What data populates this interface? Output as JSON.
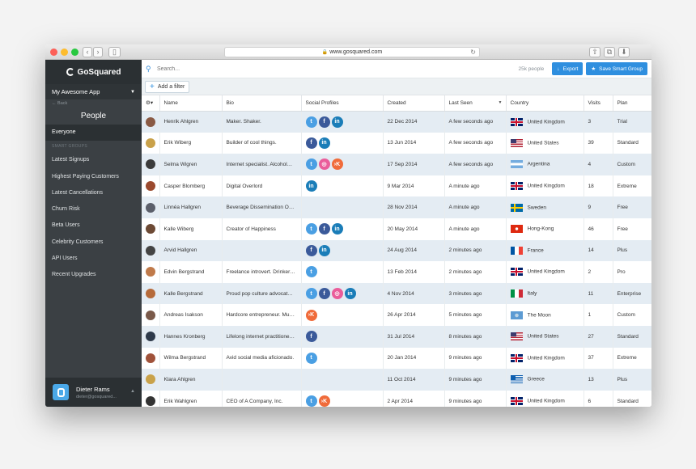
{
  "browser": {
    "url": "www.gosquared.com",
    "back": "‹",
    "forward": "›",
    "reload": "↻"
  },
  "sidebar": {
    "logo": "GoSquared",
    "app_name": "My Awesome App",
    "back_label": "← Back",
    "section": "People",
    "everyone": "Everyone",
    "groups_header": "SMART GROUPS",
    "groups": [
      "Latest Signups",
      "Highest Paying Customers",
      "Latest Cancellations",
      "Churn Risk",
      "Beta Users",
      "Celebrity Customers",
      "API Users",
      "Recent Upgrades"
    ],
    "user_name": "Dieter Rams",
    "user_email": "dieter@gosquared..."
  },
  "toolbar": {
    "search_placeholder": "Search...",
    "count": "25k people",
    "export_label": "Export",
    "save_label": "Save Smart Group",
    "add_filter": "Add a filter"
  },
  "columns": [
    "Name",
    "Bio",
    "Social Profiles",
    "Created",
    "Last Seen",
    "Country",
    "Visits",
    "Plan"
  ],
  "rows": [
    {
      "name": "Henrik Ahlgren",
      "bio": "Maker. Shaker.",
      "social": [
        "twitter",
        "facebook",
        "linkedin"
      ],
      "created": "22 Dec 2014",
      "last_seen": "A few seconds ago",
      "country": "United Kingdom",
      "visits": "3",
      "plan": "Trial",
      "avatar_color": "#8a5a44"
    },
    {
      "name": "Erik Wiberg",
      "bio": "Builder of cool things.",
      "social": [
        "facebook",
        "linkedin"
      ],
      "created": "13 Jun 2014",
      "last_seen": "A few seconds ago",
      "country": "United States",
      "visits": "39",
      "plan": "Standard",
      "avatar_color": "#c9a14a"
    },
    {
      "name": "Selma Wigren",
      "bio": "Internet specialist. Alcohol…",
      "social": [
        "twitter",
        "dribbble",
        "klout"
      ],
      "created": "17 Sep 2014",
      "last_seen": "A few seconds ago",
      "country": "Argentina",
      "visits": "4",
      "plan": "Custom",
      "avatar_color": "#3b3b3b"
    },
    {
      "name": "Casper Blomberg",
      "bio": "Digital Overlord",
      "social": [
        "linkedin"
      ],
      "created": "9 Mar 2014",
      "last_seen": "A minute ago",
      "country": "United Kingdom",
      "visits": "18",
      "plan": "Extreme",
      "avatar_color": "#9b4a2e"
    },
    {
      "name": "Linnéa Hallgren",
      "bio": "Beverage Dissemination O…",
      "social": [],
      "created": "28 Nov 2014",
      "last_seen": "A minute ago",
      "country": "Sweden",
      "visits": "9",
      "plan": "Free",
      "avatar_color": "#5b5f6a"
    },
    {
      "name": "Kalle Wiberg",
      "bio": "Creator of Happiness",
      "social": [
        "twitter",
        "facebook",
        "linkedin"
      ],
      "created": "20 May 2014",
      "last_seen": "A minute ago",
      "country": "Hong-Kong",
      "visits": "46",
      "plan": "Free",
      "avatar_color": "#6d4a35"
    },
    {
      "name": "Arvid Hallgren",
      "bio": "",
      "social": [
        "facebook",
        "linkedin"
      ],
      "created": "24 Aug 2014",
      "last_seen": "2 minutes ago",
      "country": "France",
      "visits": "14",
      "plan": "Plus",
      "avatar_color": "#444"
    },
    {
      "name": "Edvin Bergstrand",
      "bio": "Freelance introvert. Drinker…",
      "social": [
        "twitter"
      ],
      "created": "13 Feb 2014",
      "last_seen": "2 minutes ago",
      "country": "United Kingdom",
      "visits": "2",
      "plan": "Pro",
      "avatar_color": "#c07a4a"
    },
    {
      "name": "Kalle Bergstrand",
      "bio": "Proud pop culture advocat…",
      "social": [
        "twitter",
        "facebook",
        "dribbble",
        "linkedin"
      ],
      "created": "4 Nov 2014",
      "last_seen": "3 minutes ago",
      "country": "Italy",
      "visits": "11",
      "plan": "Enterprise",
      "avatar_color": "#b66a3a"
    },
    {
      "name": "Andreas Isakson",
      "bio": "Hardcore entrepreneur. Mu…",
      "social": [
        "klout"
      ],
      "created": "26 Apr 2014",
      "last_seen": "5 minutes ago",
      "country": "The Moon",
      "visits": "1",
      "plan": "Custom",
      "avatar_color": "#7a5a4a"
    },
    {
      "name": "Hannes Kronberg",
      "bio": "Lifelong internet practitione…",
      "social": [
        "facebook"
      ],
      "created": "31 Jul 2014",
      "last_seen": "8 minutes ago",
      "country": "United States",
      "visits": "27",
      "plan": "Standard",
      "avatar_color": "#2e3a4a"
    },
    {
      "name": "Wilma Bergstrand",
      "bio": "Avid social media aficionado.",
      "social": [
        "twitter"
      ],
      "created": "20 Jan 2014",
      "last_seen": "9 minutes ago",
      "country": "United Kingdom",
      "visits": "37",
      "plan": "Extreme",
      "avatar_color": "#a0523a"
    },
    {
      "name": "Klara Ahlgren",
      "bio": "",
      "social": [],
      "created": "11 Oct 2014",
      "last_seen": "9 minutes ago",
      "country": "Greece",
      "visits": "13",
      "plan": "Plus",
      "avatar_color": "#c9a24a"
    },
    {
      "name": "Erik Wahlgren",
      "bio": "CEO of A Company, Inc.",
      "social": [
        "twitter",
        "klout"
      ],
      "created": "2 Apr 2014",
      "last_seen": "9 minutes ago",
      "country": "United Kingdom",
      "visits": "6",
      "plan": "Standard",
      "avatar_color": "#333"
    }
  ],
  "social_colors": {
    "twitter": "#4a9fe3",
    "facebook": "#3b5a9a",
    "linkedin": "#1a7db8",
    "dribbble": "#ea5d9a",
    "klout": "#f06b3a"
  },
  "social_glyphs": {
    "twitter": "t",
    "facebook": "f",
    "linkedin": "in",
    "dribbble": "◎",
    "klout": "›K"
  }
}
